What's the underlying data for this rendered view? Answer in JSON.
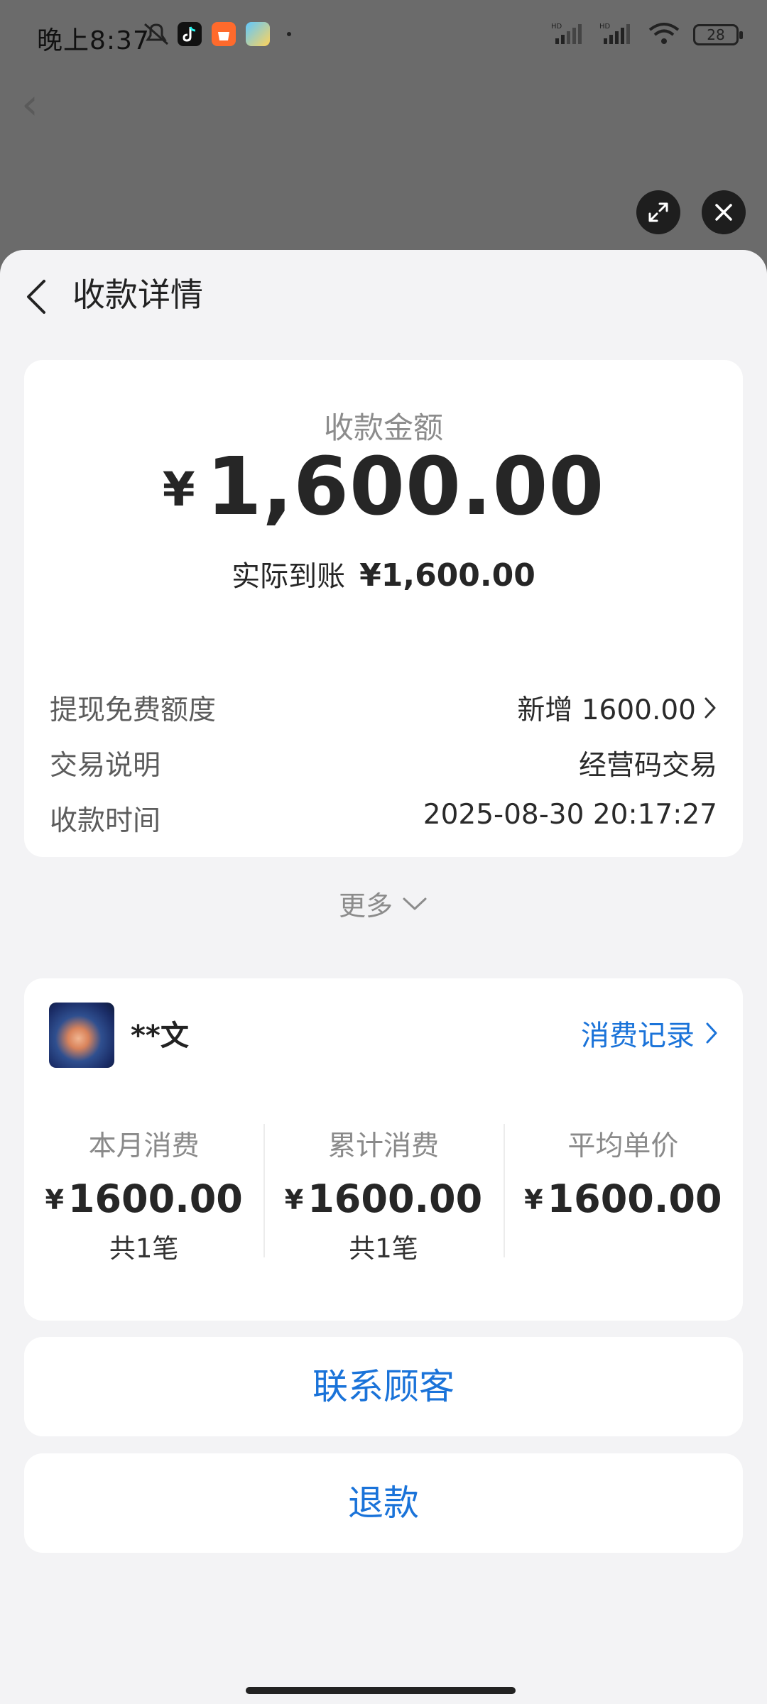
{
  "status_bar": {
    "time": "晚上8:37",
    "battery": "28",
    "app_icons": [
      "muted-bell-icon",
      "douyin-icon",
      "taobao-icon",
      "gallery-icon"
    ],
    "signal_icons": [
      "hd-signal-1-icon",
      "hd-signal-2-icon",
      "wifi-icon"
    ]
  },
  "header": {
    "title": "收款详情"
  },
  "amount_card": {
    "label": "收款金额",
    "currency": "¥",
    "amount": "1,600.00",
    "actual_label": "实际到账",
    "actual_amount": "¥1,600.00",
    "rows": [
      {
        "key": "提现免费额度",
        "value": "新增 1600.00",
        "has_arrow": true
      },
      {
        "key": "交易说明",
        "value": "经营码交易",
        "has_arrow": false
      },
      {
        "key": "收款时间",
        "value": "2025-08-30 20:17:27",
        "has_arrow": false
      }
    ],
    "more": "更多"
  },
  "customer": {
    "name": "**文",
    "record_link": "消费记录",
    "stats": [
      {
        "label": "本月消费",
        "value": "1600.00",
        "currency": "¥",
        "count": "共1笔"
      },
      {
        "label": "累计消费",
        "value": "1600.00",
        "currency": "¥",
        "count": "共1笔"
      },
      {
        "label": "平均单价",
        "value": "1600.00",
        "currency": "¥",
        "count": ""
      }
    ]
  },
  "actions": {
    "contact": "联系顾客",
    "refund": "退款"
  },
  "colors": {
    "link": "#1a73d9",
    "sheet_bg": "#f3f3f5",
    "overlay": "#6b6b6b"
  }
}
